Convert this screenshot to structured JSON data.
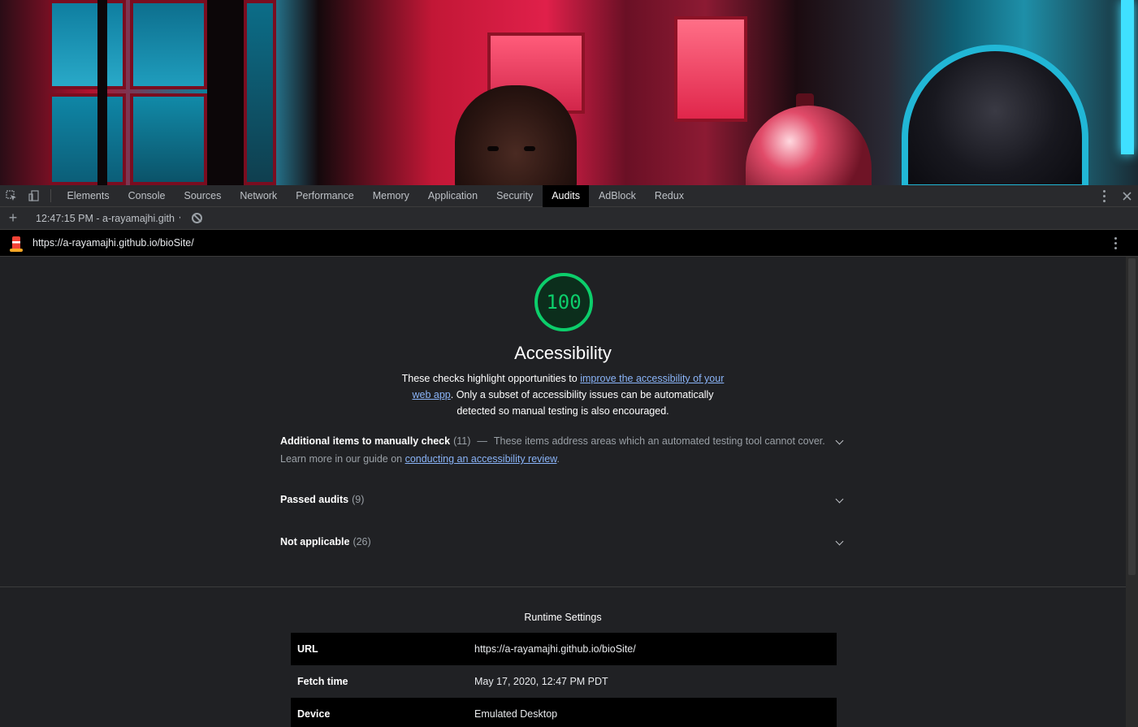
{
  "devtools": {
    "tabs": [
      "Elements",
      "Console",
      "Sources",
      "Network",
      "Performance",
      "Memory",
      "Application",
      "Security",
      "Audits",
      "AdBlock",
      "Redux"
    ],
    "active_tab": "Audits",
    "report_select": "12:47:15 PM - a-rayamajhi.gith",
    "url": "https://a-rayamajhi.github.io/bioSite/"
  },
  "category": {
    "score": "100",
    "title": "Accessibility",
    "desc_prefix": "These checks highlight opportunities to ",
    "desc_link": "improve the accessibility of your web app",
    "desc_suffix": ". Only a subset of accessibility issues can be automatically detected so manual testing is also encouraged.",
    "score_color": "#0cce6b"
  },
  "groups": {
    "manual": {
      "title": "Additional items to manually check",
      "count": "(11)",
      "dash": "—",
      "desc": "These items address areas which an automated testing tool cannot cover.",
      "learn_prefix": "Learn more in our guide on ",
      "learn_link": "conducting an accessibility review",
      "learn_suffix": "."
    },
    "passed": {
      "title": "Passed audits",
      "count": "(9)"
    },
    "na": {
      "title": "Not applicable",
      "count": "(26)"
    }
  },
  "runtime": {
    "title": "Runtime Settings",
    "rows": [
      {
        "key": "URL",
        "value": "https://a-rayamajhi.github.io/bioSite/"
      },
      {
        "key": "Fetch time",
        "value": "May 17, 2020, 12:47 PM PDT"
      },
      {
        "key": "Device",
        "value": "Emulated Desktop"
      }
    ]
  }
}
